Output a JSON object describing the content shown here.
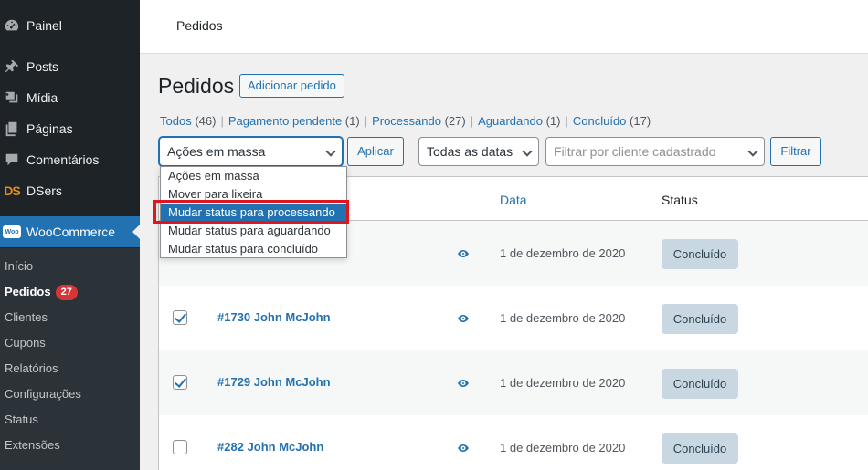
{
  "sidebar": {
    "items": [
      {
        "label": "Painel",
        "icon": "dashboard-icon"
      },
      {
        "label": "Posts",
        "icon": "pin-icon"
      },
      {
        "label": "Mídia",
        "icon": "media-icon"
      },
      {
        "label": "Páginas",
        "icon": "pages-icon"
      },
      {
        "label": "Comentários",
        "icon": "comment-icon"
      },
      {
        "label": "DSers",
        "icon": "dsers-logo",
        "logo_text": "DS"
      },
      {
        "label": "WooCommerce",
        "icon": "woocommerce-logo",
        "logo_text": "Woo"
      }
    ],
    "submenu": [
      {
        "label": "Início"
      },
      {
        "label": "Pedidos",
        "badge": "27"
      },
      {
        "label": "Clientes"
      },
      {
        "label": "Cupons"
      },
      {
        "label": "Relatórios"
      },
      {
        "label": "Configurações"
      },
      {
        "label": "Status"
      },
      {
        "label": "Extensões"
      }
    ]
  },
  "header": {
    "title": "Pedidos"
  },
  "main": {
    "title": "Pedidos",
    "add_label": "Adicionar pedido",
    "filters": [
      {
        "label": "Todos",
        "count": "(46)"
      },
      {
        "label": "Pagamento pendente",
        "count": "(1)"
      },
      {
        "label": "Processando",
        "count": "(27)"
      },
      {
        "label": "Aguardando",
        "count": "(1)"
      },
      {
        "label": "Concluído",
        "count": "(17)"
      }
    ],
    "separator": "|",
    "bulk_select": "Ações em massa",
    "apply_label": "Aplicar",
    "date_select": "Todas as datas",
    "customer_placeholder": "Filtrar por cliente cadastrado",
    "filter_label": "Filtrar"
  },
  "dropdown": {
    "options": [
      "Ações em massa",
      "Mover para lixeira",
      "Mudar status para processando",
      "Mudar status para aguardando",
      "Mudar status para concluído"
    ],
    "selected_index": 2
  },
  "table": {
    "headers": {
      "date": "Data",
      "status": "Status"
    },
    "rows": [
      {
        "order": "",
        "checked": false,
        "date": "1 de dezembro de 2020",
        "status": "Concluído"
      },
      {
        "order": "#1730 John McJohn",
        "checked": true,
        "date": "1 de dezembro de 2020",
        "status": "Concluído"
      },
      {
        "order": "#1729 John McJohn",
        "checked": true,
        "date": "1 de dezembro de 2020",
        "status": "Concluído"
      },
      {
        "order": "#282 John McJohn",
        "checked": false,
        "date": "1 de dezembro de 2020",
        "status": "Concluído"
      }
    ]
  },
  "colors": {
    "accent": "#2271b1",
    "sidebar_bg": "#1d2327",
    "highlight_box": "#e0161f",
    "badge": "#d63638"
  }
}
